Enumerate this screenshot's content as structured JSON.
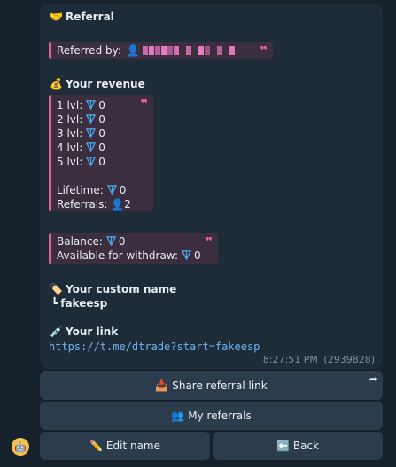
{
  "header": {
    "icon": "handshake-icon",
    "title": "Referral"
  },
  "referred": {
    "label": "Referred by:",
    "icon": "person-icon"
  },
  "revenue": {
    "icon": "money-bag-icon",
    "title": "Your revenue",
    "levels": [
      {
        "label": "1 lvl:",
        "value": "0"
      },
      {
        "label": "2 lvl:",
        "value": "0"
      },
      {
        "label": "3 lvl:",
        "value": "0"
      },
      {
        "label": "4 lvl:",
        "value": "0"
      },
      {
        "label": "5 lvl:",
        "value": "0"
      }
    ],
    "lifetime_label": "Lifetime:",
    "lifetime_value": "0",
    "referrals_label": "Referrals:",
    "referrals_value": "2"
  },
  "balance": {
    "balance_label": "Balance:",
    "balance_value": "0",
    "withdraw_label": "Available for withdraw:",
    "withdraw_value": "0"
  },
  "custom_name": {
    "icon": "label-tag-icon",
    "title": "Your custom name",
    "prefix": "┗",
    "value": "fakeesp"
  },
  "link": {
    "icon": "syringe-icon",
    "title": "Your link",
    "url": "https://t.me/dtrade?start=fakeesp"
  },
  "meta": {
    "time": "8:27:51 PM",
    "views": "(2939828)"
  },
  "buttons": {
    "share": {
      "icon": "📥",
      "label": "Share referral link"
    },
    "referrals": {
      "icon": "👥",
      "label": "My referrals"
    },
    "edit": {
      "icon": "✏️",
      "label": "Edit name"
    },
    "back": {
      "icon": "⬅️",
      "label": "Back"
    }
  },
  "colors": {
    "accent": "#e0619e",
    "link": "#6ab3f3",
    "ton": "#4aa3e8",
    "bubble": "#1e2c3a",
    "button": "#2b3c4d"
  }
}
